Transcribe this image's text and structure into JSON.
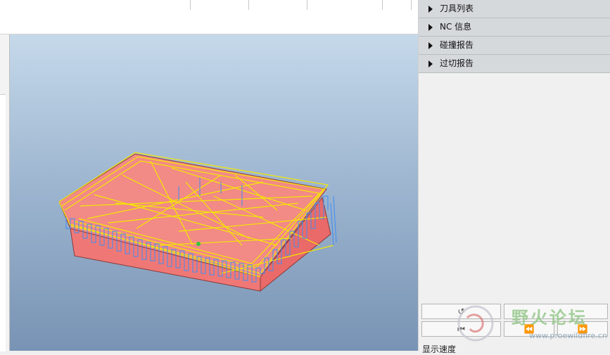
{
  "right_panel": {
    "sections": [
      {
        "label": "刀具列表"
      },
      {
        "label": "NC 信息"
      },
      {
        "label": "碰撞报告"
      },
      {
        "label": "过切报告"
      }
    ],
    "controls": {
      "refresh_glyph": "↺",
      "first_glyph": "⏮",
      "rewind_glyph": "⏪",
      "forward_glyph": "⏩"
    },
    "bottom_label": "显示速度"
  },
  "watermark": {
    "text": "野火论坛",
    "url": "www.proewildfire.cn"
  },
  "colors": {
    "model_top": "#f28a86",
    "model_side": "#ee7573",
    "toolpath_yellow": "#f4e800",
    "toolpath_blue": "#3e8ef7"
  },
  "icons": [
    "expand-triangle-icon",
    "refresh-icon",
    "first-frame-icon",
    "rewind-icon",
    "fast-forward-icon"
  ]
}
